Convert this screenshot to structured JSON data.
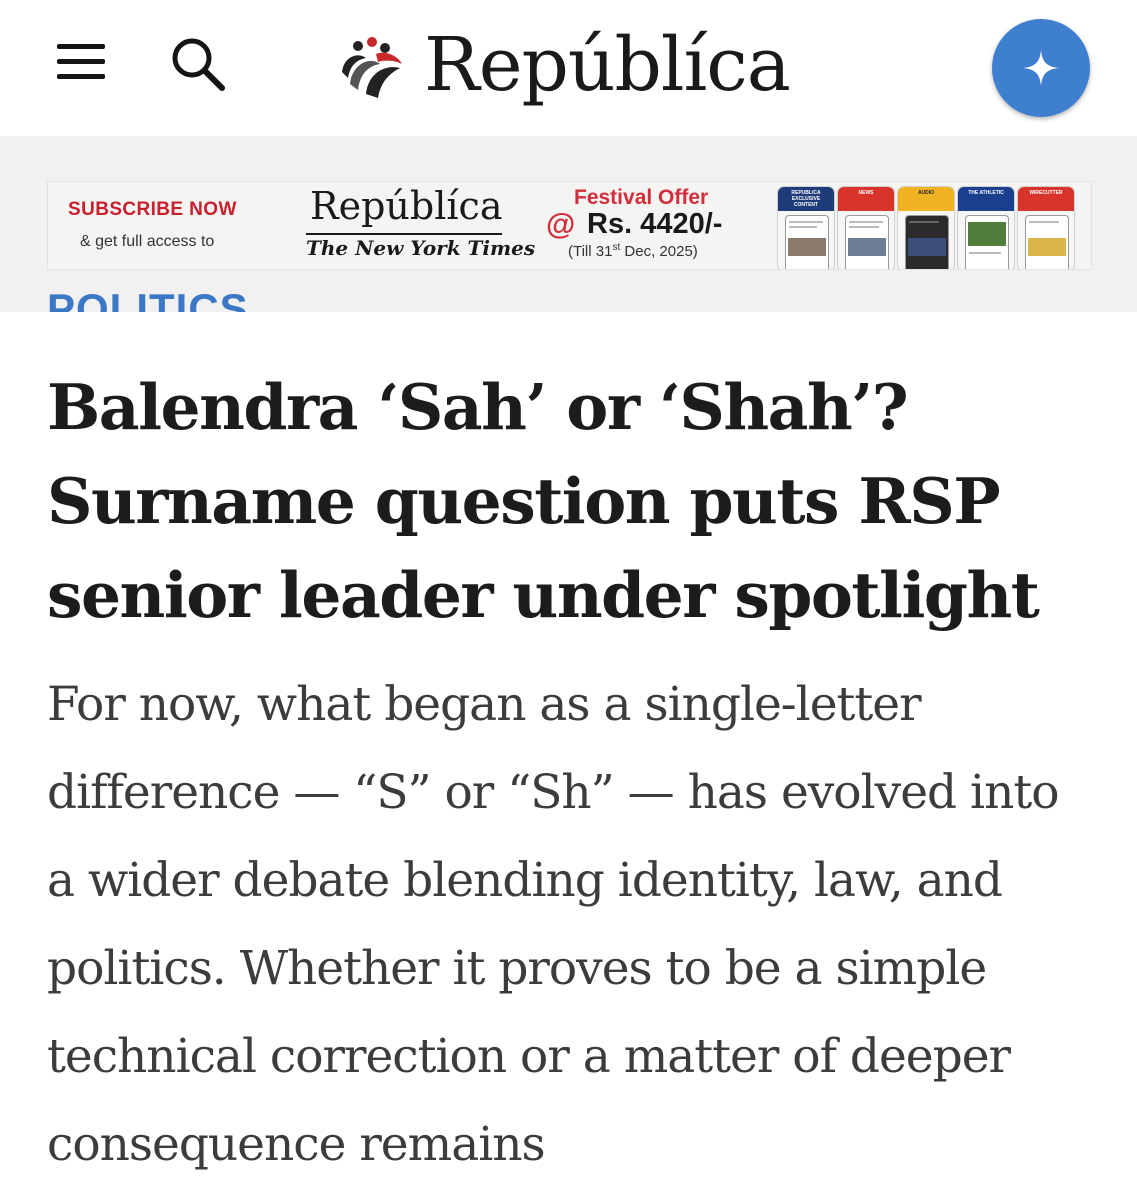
{
  "header": {
    "brand": "Repúblíca",
    "menu_icon": "hamburger-menu-icon",
    "search_icon": "search-icon",
    "ai_icon": "sparkle-icon",
    "accent_color": "#3f7fd0"
  },
  "ad": {
    "subscribe": "SUBSCRIBE NOW",
    "access": "& get full access to",
    "brand": "Repúblíca",
    "partner": "The New York Times",
    "offer_title": "Festival Offer",
    "offer_at": "@",
    "offer_price": "Rs. 4420/-",
    "offer_till_pre": "(Till 31",
    "offer_till_sup": "st",
    "offer_till_post": " Dec, 2025)",
    "phones": [
      {
        "title": "REPUBLICA EXCLUSIVE CONTENT",
        "color": "#1f3c7a"
      },
      {
        "title": "NEWS",
        "color": "#d8342b"
      },
      {
        "title": "AUDIO",
        "color": "#f0b323"
      },
      {
        "title": "THE ATHLETIC",
        "color": "#1b3f8f"
      },
      {
        "title": "WIRECUTTER",
        "color": "#d8342b"
      }
    ]
  },
  "article": {
    "category": "POLITICS",
    "headline": "Balendra ‘Sah’ or ‘Shah’? Surname question puts RSP senior leader under spotlight",
    "lede": "For now, what began as a single-letter difference — “S” or “Sh” — has evolved into a wider debate blending identity, law, and politics. Whether it proves to be a simple technical correction or a matter of deeper consequence remains"
  }
}
